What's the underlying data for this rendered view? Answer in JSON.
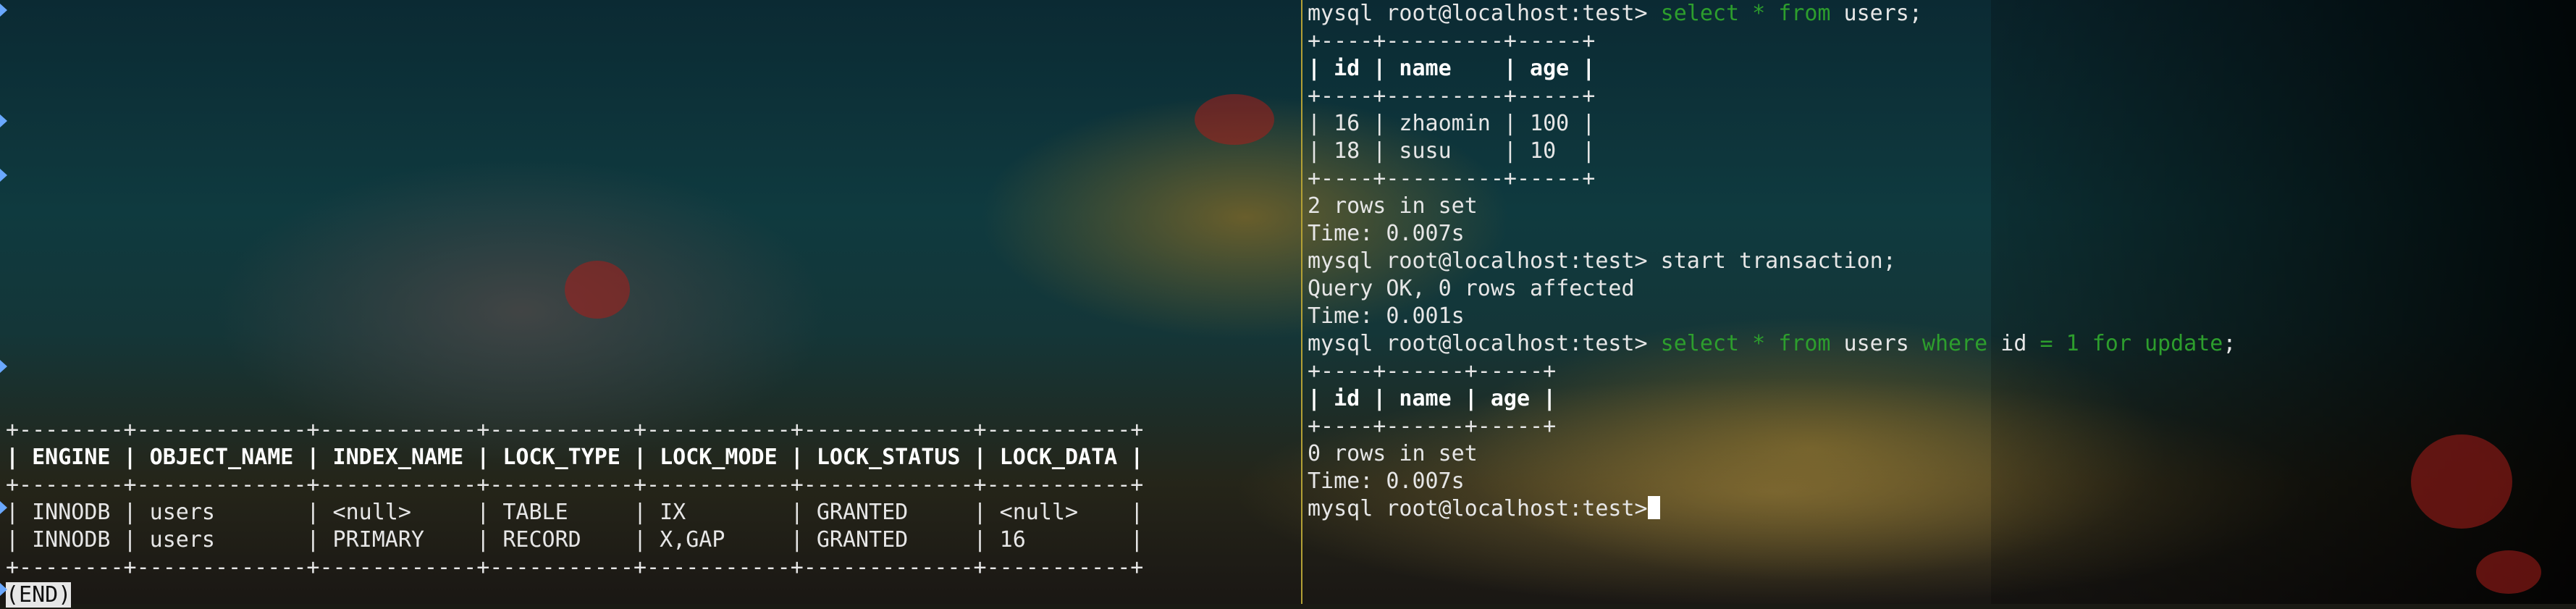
{
  "left_pane": {
    "lock_table": {
      "border": "+--------+-------------+------------+-----------+-----------+-------------+-----------+",
      "header_row": "| ENGINE | OBJECT_NAME | INDEX_NAME | LOCK_TYPE | LOCK_MODE | LOCK_STATUS | LOCK_DATA |",
      "rows": [
        "| INNODB | users       | <null>     | TABLE     | IX        | GRANTED     | <null>    |",
        "| INNODB | users       | PRIMARY    | RECORD    | X,GAP     | GRANTED     | 16        |"
      ]
    },
    "end_marker": "(END)"
  },
  "right_pane": {
    "prompt": "mysql root@localhost:test>",
    "cmd1": {
      "kw1": "select",
      "star": "*",
      "kw2": "from",
      "rest": "users;"
    },
    "users_table": {
      "border": "+----+---------+-----+",
      "header_row": "| id | name    | age |",
      "rows": [
        "| 16 | zhaomin | 100 |",
        "| 18 | susu    | 10  |"
      ]
    },
    "result1": "2 rows in set",
    "time1": "Time: 0.007s",
    "cmd2": "start transaction;",
    "result2": "Query OK, 0 rows affected",
    "time2": "Time: 0.001s",
    "cmd3": {
      "kw1": "select",
      "star": "*",
      "kw2": "from",
      "table": "users",
      "kw3": "where",
      "col": "id",
      "op": "=",
      "val": "1",
      "kw4": "for update",
      "end": ";"
    },
    "empty_table": {
      "border": "+----+------+-----+",
      "header_row": "| id | name | age |"
    },
    "result3": "0 rows in set",
    "time3": "Time: 0.007s"
  }
}
